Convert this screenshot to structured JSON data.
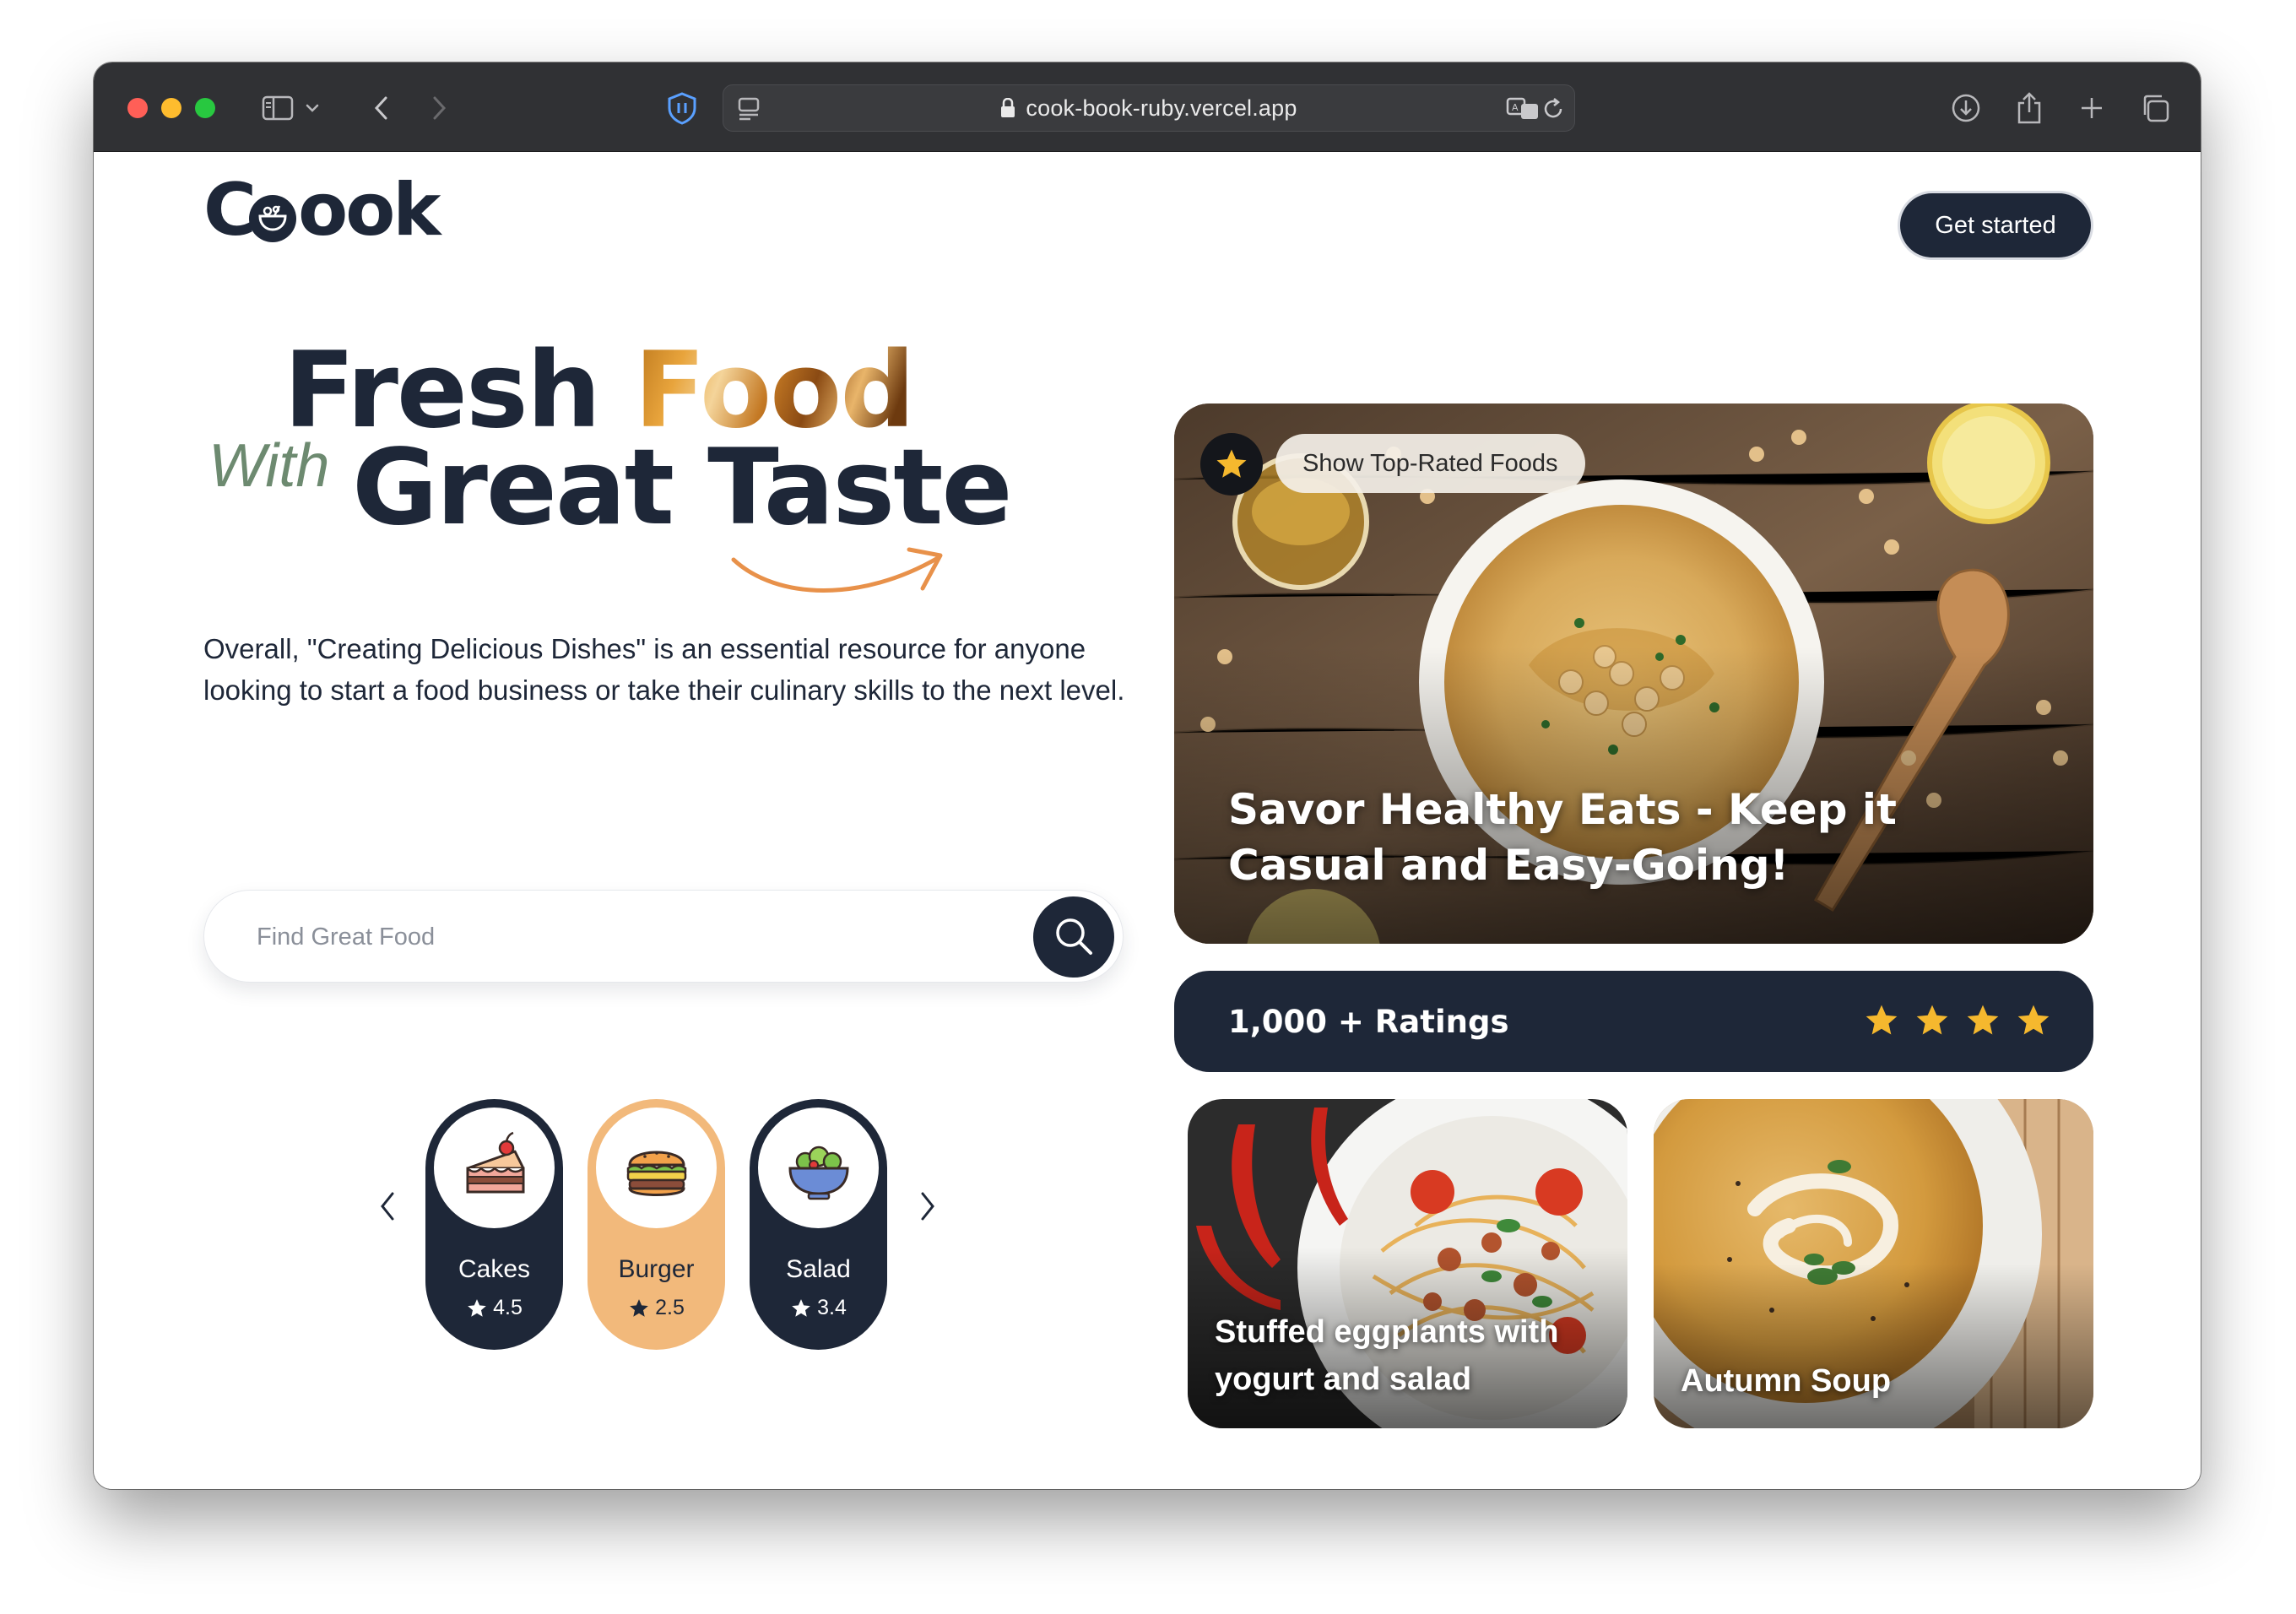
{
  "browser": {
    "url": "cook-book-ruby.vercel.app"
  },
  "header": {
    "logo_prefix": "C",
    "logo_suffix": "ook",
    "cta_label": "Get started"
  },
  "hero": {
    "line1_a": "Fresh ",
    "line1_b": "Food",
    "with": "With",
    "line2": "Great Taste",
    "description": "Overall, \"Creating Delicious Dishes\" is an essential resource for anyone looking to start a food business or take their culinary skills to the next level."
  },
  "search": {
    "placeholder": "Find Great Food",
    "value": ""
  },
  "categories": [
    {
      "name": "Cakes",
      "rating": "4.5",
      "icon": "cake-icon",
      "active": false
    },
    {
      "name": "Burger",
      "rating": "2.5",
      "icon": "burger-icon",
      "active": true
    },
    {
      "name": "Salad",
      "rating": "3.4",
      "icon": "salad-icon",
      "active": false
    }
  ],
  "feature": {
    "badge_label": "Show Top-Rated Foods",
    "title": "Savor Healthy Eats - Keep it Casual and Easy-Going!"
  },
  "ratings": {
    "label": "1,000 + Ratings",
    "stars": 4
  },
  "dishes": [
    {
      "title": "Stuffed eggplants with yogurt and salad"
    },
    {
      "title": "Autumn Soup"
    }
  ],
  "colors": {
    "navy": "#1e2738",
    "accent_orange": "#f2b97b",
    "star_gold": "#f5b82e",
    "with_green": "#6d8a70",
    "arrow_orange": "#e8914a"
  }
}
